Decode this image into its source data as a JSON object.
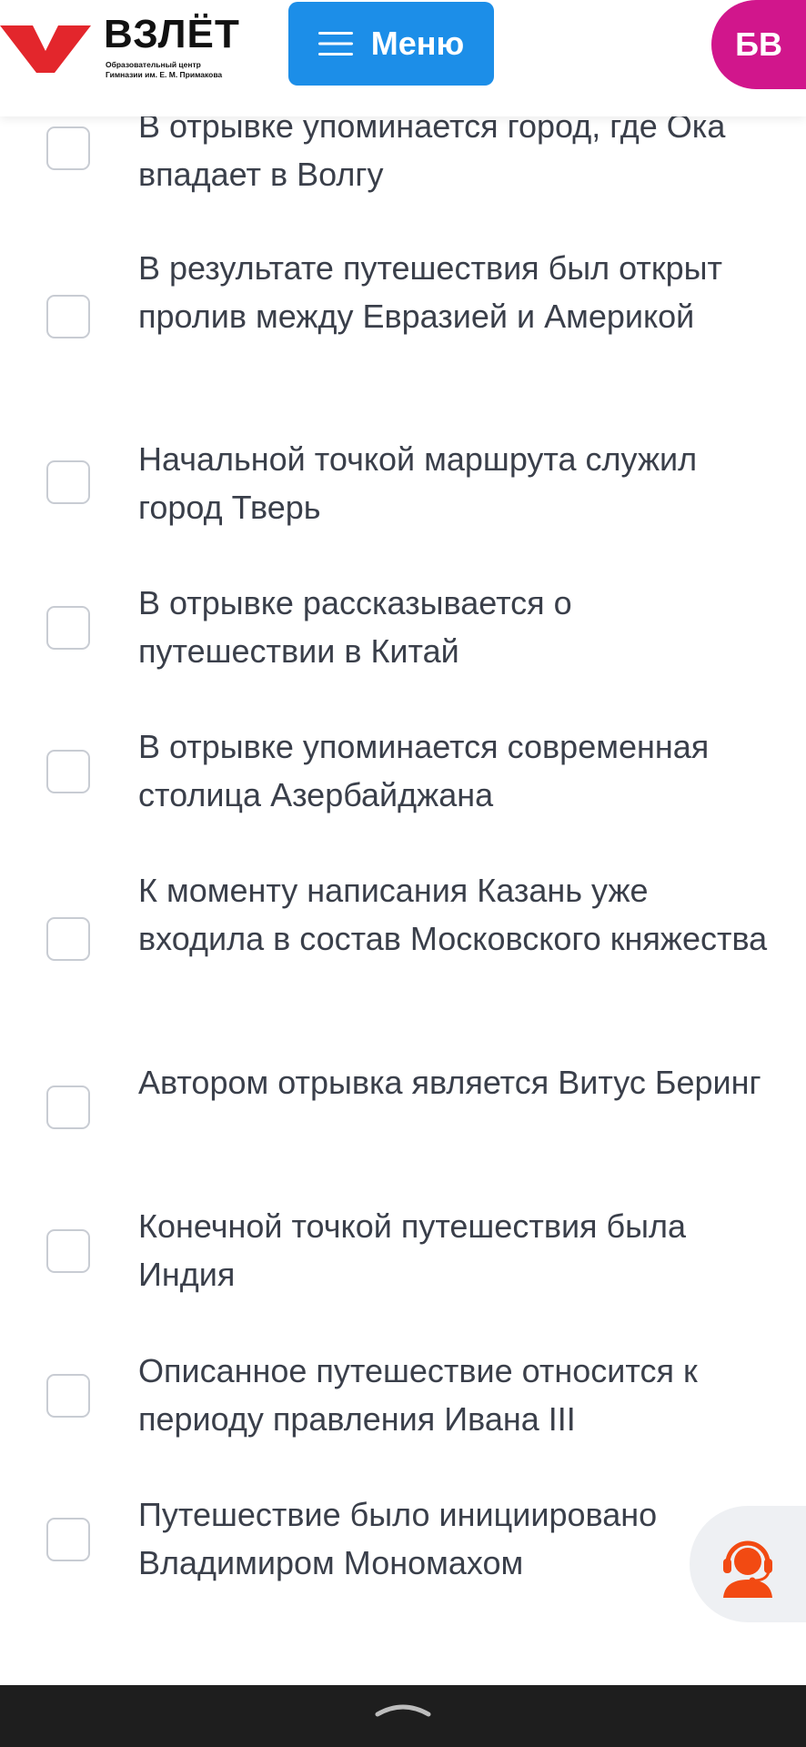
{
  "header": {
    "logo_title": "ВЗЛЁТ",
    "logo_subtitle_line1": "Образовательный центр",
    "logo_subtitle_line2": "Гимназии им. Е. М. Примакова",
    "menu_label": "Меню",
    "menu_icon": "hamburger-icon",
    "avatar_initials": "БВ"
  },
  "colors": {
    "brand_red": "#e3262c",
    "menu_blue": "#1c8ee8",
    "avatar_magenta": "#d1168c",
    "support_orange": "#f24a12"
  },
  "options": [
    {
      "text": "В отрывке упоминается город, где Ока впадает в Волгу",
      "checked": false
    },
    {
      "text": "В результате путешествия был открыт пролив между Евразией и Америкой",
      "checked": false
    },
    {
      "text": "Начальной точкой маршрута служил город Тверь",
      "checked": false
    },
    {
      "text": "В отрывке рассказывается о путешествии в Китай",
      "checked": false
    },
    {
      "text": "В отрывке упоминается современная столица Азербайджана",
      "checked": false
    },
    {
      "text": "К моменту написания Казань уже входила в состав Московского княжества",
      "checked": false
    },
    {
      "text": "Автором отрывка является Витус Беринг",
      "checked": false
    },
    {
      "text": "Конечной точкой путешествия была Индия",
      "checked": false
    },
    {
      "text": "Описанное путешествие относится к периоду правления Ивана III",
      "checked": false
    },
    {
      "text": "Путешествие было инициировано Владимиром Мономахом",
      "checked": false
    }
  ],
  "support_icon": "support-agent-icon",
  "nav_icon": "chevron-up-icon"
}
